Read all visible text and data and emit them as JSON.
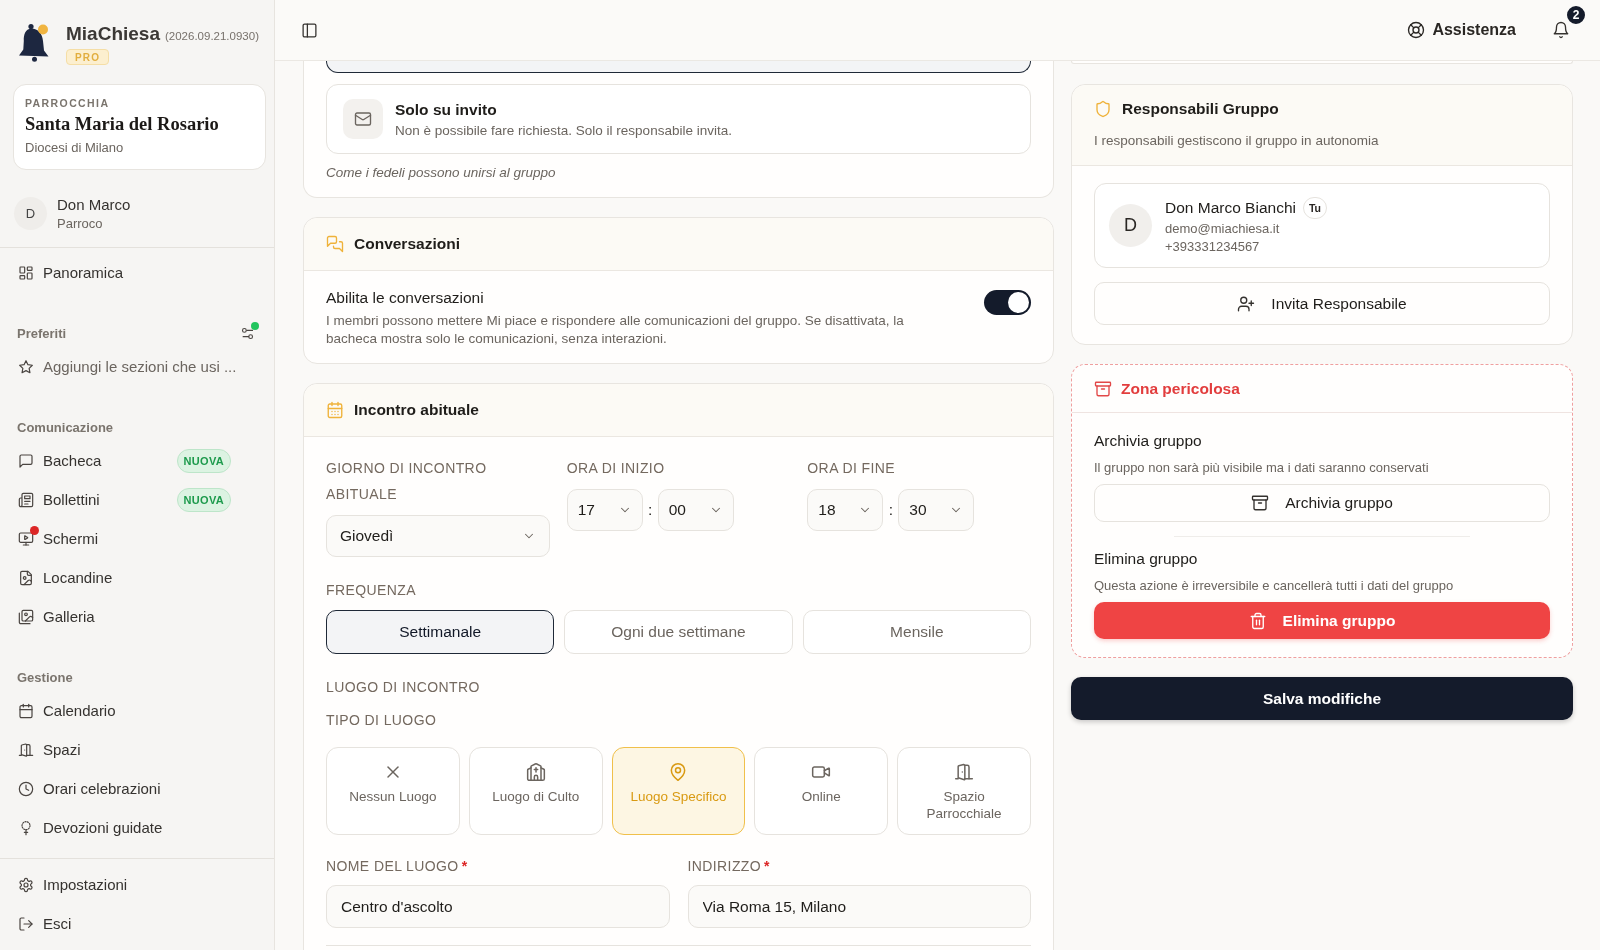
{
  "app": {
    "name": "MiaChiesa",
    "version": "(2026.09.21.0930)",
    "plan": "PRO"
  },
  "parish": {
    "label": "PARROCCHIA",
    "name": "Santa Maria del Rosario",
    "diocese": "Diocesi di Milano"
  },
  "user": {
    "initial": "D",
    "name": "Don Marco",
    "role": "Parroco"
  },
  "sidebar": {
    "sections": [
      {
        "items": [
          {
            "label": "Panoramica",
            "alert": false
          }
        ]
      },
      {
        "title": "Preferiti",
        "filter_active": true,
        "hint": "Aggiungi le sezioni che usi ..."
      },
      {
        "title": "Comunicazione",
        "items": [
          {
            "label": "Bacheca",
            "badge": "NUOVA",
            "alert": false
          },
          {
            "label": "Bollettini",
            "badge": "NUOVA",
            "alert": false
          },
          {
            "label": "Schermi",
            "alert": true
          },
          {
            "label": "Locandine",
            "alert": false
          },
          {
            "label": "Galleria",
            "alert": false
          }
        ]
      },
      {
        "title": "Gestione",
        "items": [
          {
            "label": "Calendario",
            "alert": false
          },
          {
            "label": "Spazi",
            "alert": false
          },
          {
            "label": "Orari celebrazioni",
            "alert": false
          },
          {
            "label": "Devozioni guidate",
            "alert": false
          }
        ]
      }
    ],
    "footer": [
      {
        "label": "Impostazioni",
        "alert": false
      },
      {
        "label": "Esci",
        "alert": false
      }
    ]
  },
  "topbar": {
    "help": "Assistenza",
    "notifications": "2"
  },
  "membership": {
    "options": [
      {
        "selected": true
      },
      {
        "title": "Solo su invito",
        "description": "Non è possibile fare richiesta. Solo il responsabile invita.",
        "selected": false
      }
    ],
    "hint": "Come i fedeli possono unirsi al gruppo"
  },
  "conversations": {
    "title": "Conversazioni",
    "setting": "Abilita le conversazioni",
    "description": "I membri possono mettere Mi piace e rispondere alle comunicazioni del gruppo. Se disattivata, la bacheca mostra solo le comunicazioni, senza interazioni.",
    "on": true
  },
  "meeting": {
    "title": "Incontro abituale",
    "day": {
      "label": "GIORNO DI INCONTRO ABITUALE",
      "value": "Giovedì"
    },
    "start": {
      "label": "ORA DI INIZIO",
      "hour": "17",
      "separator": ":",
      "minute": "00"
    },
    "end": {
      "label": "ORA DI FINE",
      "hour": "18",
      "separator": ":",
      "minute": "30"
    },
    "frequency": {
      "label": "FREQUENZA",
      "options": [
        {
          "label": "Settimanale",
          "selected": true
        },
        {
          "label": "Ogni due settimane",
          "selected": false
        },
        {
          "label": "Mensile",
          "selected": false
        }
      ]
    },
    "place_heading": "LUOGO DI INCONTRO",
    "place_type": {
      "label": "TIPO DI LUOGO",
      "options": [
        {
          "label": "Nessun Luogo",
          "selected": false
        },
        {
          "label": "Luogo di Culto",
          "selected": false
        },
        {
          "label": "Luogo Specifico",
          "selected": true
        },
        {
          "label": "Online",
          "selected": false
        },
        {
          "label": "Spazio Parrocchiale",
          "selected": false
        }
      ]
    },
    "fields": [
      {
        "label": "NOME DEL LUOGO",
        "required_mark": "*",
        "value": "Centro d'ascolto"
      },
      {
        "label": "INDIRIZZO",
        "required_mark": "*",
        "value": "Via Roma 15, Milano"
      }
    ]
  },
  "leaders": {
    "title": "Responsabili Gruppo",
    "subtitle": "I responsabili gestiscono il gruppo in autonomia",
    "members": [
      {
        "initial": "D",
        "name": "Don Marco Bianchi",
        "badge": "Tu",
        "email": "demo@miachiesa.it",
        "phone": "+393331234567"
      }
    ],
    "invite_button": "Invita Responsabile"
  },
  "danger_zone": {
    "title": "Zona pericolosa",
    "actions": [
      {
        "kind": "archive",
        "title": "Archivia gruppo",
        "description": "Il gruppo non sarà più visibile ma i dati saranno conservati",
        "button": "Archivia gruppo"
      },
      {
        "kind": "delete",
        "title": "Elimina gruppo",
        "description": "Questa azione è irreversibile e cancellerà tutti i dati del gruppo",
        "button": "Elimina gruppo"
      }
    ]
  },
  "save_button": "Salva modifiche"
}
